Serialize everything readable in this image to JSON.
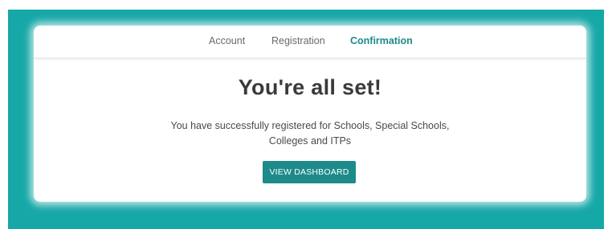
{
  "steps": {
    "items": [
      {
        "label": "Account",
        "state": "complete"
      },
      {
        "label": "Registration",
        "state": "complete"
      },
      {
        "label": "Confirmation",
        "state": "active"
      }
    ]
  },
  "confirmation": {
    "headline": "You're all set!",
    "message_line1": "You have successfully registered for Schools, Special Schools,",
    "message_line2": "Colleges and ITPs",
    "cta_label": "VIEW DASHBOARD"
  },
  "colors": {
    "background": "#16a7a7",
    "accent": "#1e8a8a",
    "card": "#ffffff"
  }
}
